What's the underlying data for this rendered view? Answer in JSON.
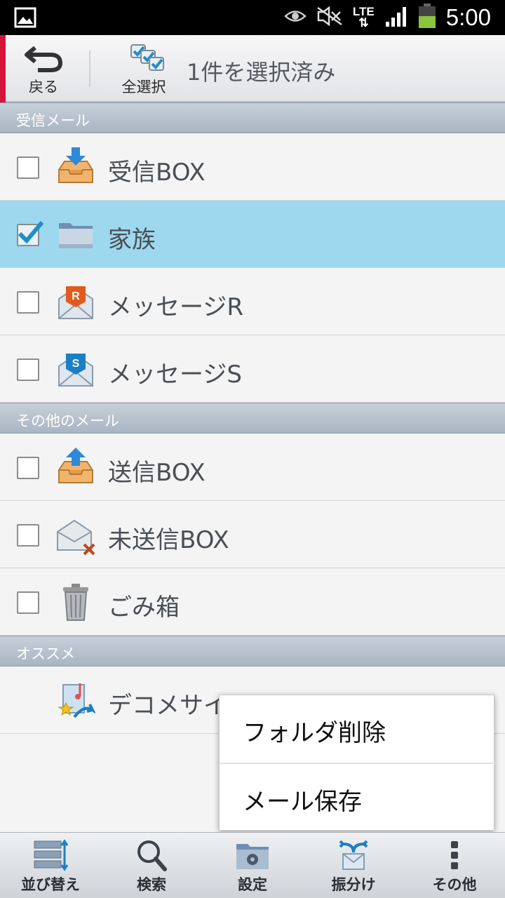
{
  "status_bar": {
    "time": "5:00",
    "network": "LTE",
    "icons": [
      "image-icon",
      "eye-icon",
      "mute-icon",
      "lte-icon",
      "signal-icon",
      "battery-icon"
    ]
  },
  "action_bar": {
    "back_label": "戻る",
    "select_all_label": "全選択",
    "title": "1件を選択済み",
    "accent_color": "#d4143b"
  },
  "sections": [
    {
      "header": "受信メール",
      "rows": [
        {
          "label": "受信BOX",
          "icon": "inbox-icon",
          "checked": false
        },
        {
          "label": "家族",
          "icon": "folder-icon",
          "checked": true
        },
        {
          "label": "メッセージR",
          "icon": "message-r-icon",
          "checked": false
        },
        {
          "label": "メッセージS",
          "icon": "message-s-icon",
          "checked": false
        }
      ]
    },
    {
      "header": "その他のメール",
      "rows": [
        {
          "label": "送信BOX",
          "icon": "outbox-icon",
          "checked": false
        },
        {
          "label": "未送信BOX",
          "icon": "unsent-icon",
          "checked": false
        },
        {
          "label": "ごみ箱",
          "icon": "trash-icon",
          "checked": false
        }
      ]
    },
    {
      "header": "オススメ",
      "rows": [
        {
          "label": "デコメサイトへ",
          "icon": "deco-site-icon"
        }
      ]
    }
  ],
  "popup_menu": {
    "items": [
      "フォルダ削除",
      "メール保存"
    ]
  },
  "toolbar": {
    "items": [
      {
        "label": "並び替え",
        "icon": "sort-icon"
      },
      {
        "label": "検索",
        "icon": "search-icon"
      },
      {
        "label": "設定",
        "icon": "settings-folder-icon"
      },
      {
        "label": "振分け",
        "icon": "sort-mail-icon"
      },
      {
        "label": "その他",
        "icon": "more-icon"
      }
    ]
  },
  "colors": {
    "selected_row": "#9dd8ef",
    "section_header": "#a9b5c2",
    "checkmark": "#1f8fc4"
  }
}
